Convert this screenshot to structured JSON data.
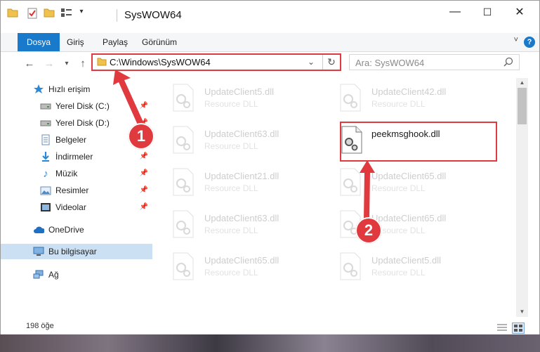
{
  "window": {
    "title": "SysWOW64",
    "controls": {
      "minimize": "—",
      "maximize": "☐",
      "close": "✕"
    }
  },
  "ribbon": {
    "tabs": [
      "Dosya",
      "Giriş",
      "Paylaş",
      "Görünüm"
    ],
    "help_label": "?"
  },
  "navigation": {
    "address": "C:\\Windows\\SysWOW64",
    "search_placeholder": "Ara: SysWOW64"
  },
  "sidebar": {
    "quick_access": "Hızlı erişim",
    "items": [
      {
        "label": "Yerel Disk (C:)",
        "icon": "drive-icon",
        "pinned": true
      },
      {
        "label": "Yerel Disk (D:)",
        "icon": "drive-icon",
        "pinned": true
      },
      {
        "label": "Belgeler",
        "icon": "documents-icon",
        "pinned": true
      },
      {
        "label": "İndirmeler",
        "icon": "downloads-icon",
        "pinned": true
      },
      {
        "label": "Müzik",
        "icon": "music-icon",
        "pinned": true
      },
      {
        "label": "Resimler",
        "icon": "pictures-icon",
        "pinned": true
      },
      {
        "label": "Videolar",
        "icon": "videos-icon",
        "pinned": true
      }
    ],
    "onedrive": "OneDrive",
    "this_pc": "Bu bilgisayar",
    "network": "Ağ"
  },
  "files": [
    {
      "name": "UpdateClient5.dll",
      "type": "Resource DLL",
      "faded": true
    },
    {
      "name": "UpdateClient42.dll",
      "type": "Resource DLL",
      "faded": true
    },
    {
      "name": "UpdateClient63.dll",
      "type": "Resource DLL",
      "faded": true
    },
    {
      "name": "peekmsghook.dll",
      "type": "",
      "faded": false
    },
    {
      "name": "UpdateClient21.dll",
      "type": "Resource DLL",
      "faded": true
    },
    {
      "name": "UpdateClient65.dll",
      "type": "Resource DLL",
      "faded": true
    },
    {
      "name": "UpdateClient63.dll",
      "type": "Resource DLL",
      "faded": true
    },
    {
      "name": "UpdateClient65.dll",
      "type": "Resource DLL",
      "faded": true
    },
    {
      "name": "UpdateClient65.dll",
      "type": "Resource DLL",
      "faded": true
    },
    {
      "name": "UpdateClient5.dll",
      "type": "Resource DLL",
      "faded": true
    }
  ],
  "status": {
    "item_count": "198 öğe"
  },
  "annotations": {
    "marker1": "1",
    "marker2": "2"
  },
  "colors": {
    "accent": "#1979ca",
    "highlight": "#e03a3e",
    "folder": "#f0c24b"
  }
}
